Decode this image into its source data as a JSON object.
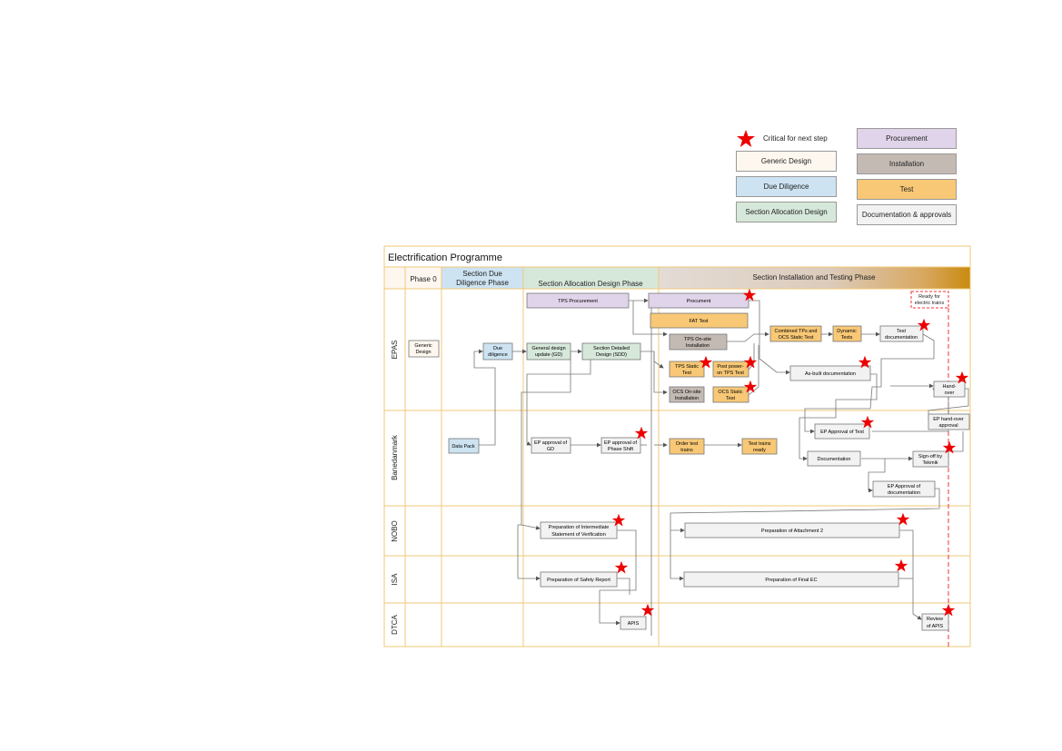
{
  "legend": {
    "critical_label": "Critical for next step",
    "generic_design": "Generic Design",
    "due_diligence": "Due Diligence",
    "section_allocation_design": "Section Allocation Design",
    "procurement": "Procurement",
    "installation": "Installation",
    "test": "Test",
    "documentation_approvals": "Documentation & approvals"
  },
  "colors": {
    "generic": "#fdf7ef",
    "due": "#cde3f2",
    "sad": "#d6e8da",
    "procurement": "#e0d4ea",
    "installation": "#c4bab4",
    "test": "#f8c876",
    "doc": "#f2f2f2",
    "grid": "#f0c878",
    "star": "#ee0000",
    "dashed": "#ee3333"
  },
  "diagram": {
    "title": "Electrification Programme",
    "phases": {
      "phase0": "Phase 0",
      "due_l1": "Section Due",
      "due_l2": "Diligence Phase",
      "sad": "Section Allocation Design Phase",
      "install": "Section Installation and Testing Phase"
    },
    "lanes": {
      "epas": "EPAS",
      "banedanmark": "Banedanmark",
      "nobo": "NOBO",
      "isa": "ISA",
      "dtca": "DTCA"
    },
    "ready_l1": "Ready for",
    "ready_l2": "electric trains",
    "nodes": {
      "generic_design_l1": "Generic",
      "generic_design_l2": "Design",
      "due_diligence_l1": "Due",
      "due_diligence_l2": "diligence",
      "general_design_l1": "General design",
      "general_design_l2": "update (GD)",
      "section_detailed_l1": "Section Detailed",
      "section_detailed_l2": "Design (SDD)",
      "tps_procurement": "TPS Procurement",
      "procument": "Procument",
      "fat_test": "FAT Test",
      "tps_onsite_l1": "TPS On-site",
      "tps_onsite_l2": "Installation",
      "tps_static_l1": "TPS Static",
      "tps_static_l2": "Test",
      "post_power_l1": "Post power-",
      "post_power_l2": "on TPS Test",
      "ocs_onsite_l1": "OCS On-site",
      "ocs_onsite_l2": "Installation",
      "ocs_static_l1": "OCS Static",
      "ocs_static_l2": "Test",
      "combined_l1": "Combined TPs and",
      "combined_l2": "OCS Static Test",
      "dynamic_l1": "Dynamic",
      "dynamic_l2": "Tests",
      "test_doc_l1": "Test",
      "test_doc_l2": "documentation",
      "asbuilt": "As-built documentation",
      "handover_l1": "Hand-",
      "handover_l2": "over",
      "ep_handover_l1": "EP hand-over",
      "ep_handover_l2": "approval",
      "data_pack": "Data Pack",
      "ep_approval_gd_l1": "EP approval of",
      "ep_approval_gd_l2": "GD",
      "ep_phase_shift_l1": "EP approval of",
      "ep_phase_shift_l2": "Phase Shift",
      "order_test_l1": "Order test",
      "order_test_l2": "trains",
      "test_trains_l1": "Test trains",
      "test_trains_l2": "ready",
      "ep_approval_test": "EP Approval of Test",
      "documentation": "Documentation",
      "signoff_l1": "Sign-off by",
      "signoff_l2": "Tekmik",
      "ep_approval_doc_l1": "EP Approval of",
      "ep_approval_doc_l2": "documentation",
      "prep_isv_l1": "Preparation of Intermediate",
      "prep_isv_l2": "Statement of Verification",
      "prep_att2": "Preparation of Attachment 2",
      "prep_safety": "Preparation of Safety Report",
      "prep_final_ec": "Preparation of Final EC",
      "apis": "APIS",
      "review_apis_l1": "Review",
      "review_apis_l2": "of APIS"
    }
  }
}
